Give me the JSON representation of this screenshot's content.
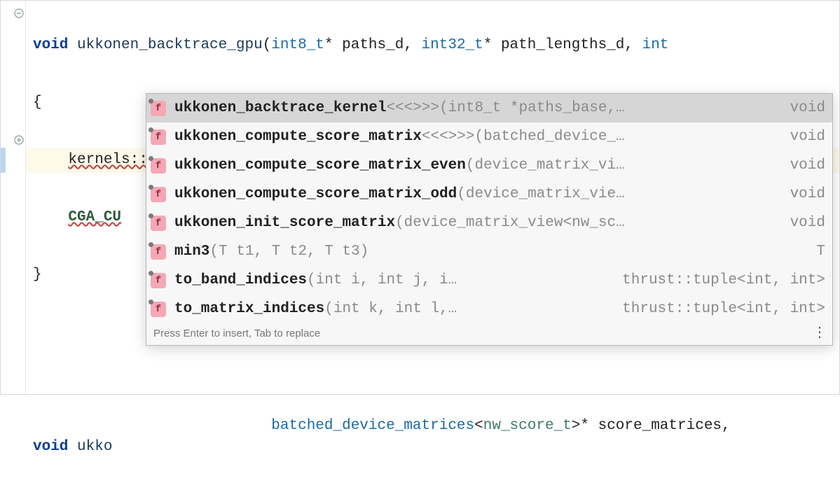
{
  "code": {
    "line1": {
      "kw": "void",
      "fn": " ukkonen_backtrace_gpu",
      "sig_open": "(",
      "t1": "int8_t",
      "p1": "* paths_d, ",
      "t2": "int32_t",
      "p2": "* path_lengths_d, ",
      "t3": "int"
    },
    "line2": "{",
    "line3": {
      "indent": "    ",
      "text": "kernels::"
    },
    "line4": {
      "indent": "    ",
      "text": "CGA_CU"
    },
    "line5": "}",
    "line6_kw": "void",
    "line6_fn": " ukko",
    "bottom": {
      "indent": "                     ",
      "type": "batched_device_matrices",
      "tpl_open": "<",
      "tpl_arg": "nw_score_t",
      "tpl_close": ">",
      "rest": "* score_matrices,"
    }
  },
  "autocomplete": {
    "hint": "Press Enter to insert, Tab to replace",
    "items": [
      {
        "icon": "f",
        "name": "ukkonen_backtrace_kernel",
        "params": "<<<>>>(int8_t *paths_base,…",
        "ret": "void"
      },
      {
        "icon": "f",
        "name": "ukkonen_compute_score_matrix",
        "params": "<<<>>>(batched_device_…",
        "ret": "void"
      },
      {
        "icon": "f",
        "name": "ukkonen_compute_score_matrix_even",
        "params": "(device_matrix_vi…",
        "ret": "void"
      },
      {
        "icon": "f",
        "name": "ukkonen_compute_score_matrix_odd",
        "params": "(device_matrix_vie…",
        "ret": "void"
      },
      {
        "icon": "f",
        "name": "ukkonen_init_score_matrix",
        "params": "(device_matrix_view<nw_sc…",
        "ret": "void"
      },
      {
        "icon": "f",
        "name": "min3",
        "params": "(T t1, T t2, T t3)",
        "ret": "T"
      },
      {
        "icon": "f",
        "name": "to_band_indices",
        "params": "(int i, int j, i…",
        "ret": "thrust::tuple<int, int>"
      },
      {
        "icon": "f",
        "name": "to_matrix_indices",
        "params": "(int k, int l,…",
        "ret": "thrust::tuple<int, int>"
      }
    ]
  }
}
